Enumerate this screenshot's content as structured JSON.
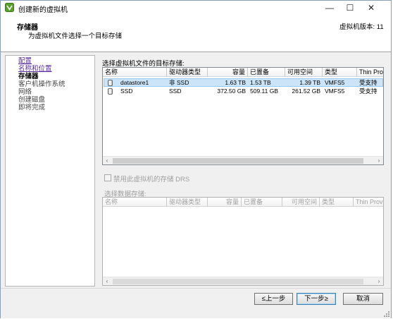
{
  "window": {
    "title": "创建新的虚拟机",
    "header_title": "存储器",
    "header_subtitle": "为虚拟机文件选择一个目标存储",
    "version_label": "虚拟机版本: 11"
  },
  "nav": {
    "items": [
      {
        "label": "配置",
        "state": "link"
      },
      {
        "label": "名称和位置",
        "state": "link"
      },
      {
        "label": "存储器",
        "state": "current"
      },
      {
        "label": "客户机操作系统",
        "state": "future"
      },
      {
        "label": "网络",
        "state": "future"
      },
      {
        "label": "创建磁盘",
        "state": "future"
      },
      {
        "label": "即将完成",
        "state": "future"
      }
    ]
  },
  "storage": {
    "section_label": "选择虚拟机文件的目标存储:",
    "columns": [
      "名称",
      "驱动器类型",
      "容量",
      "已置备",
      "可用空间",
      "类型",
      "Thin Provi"
    ],
    "rows": [
      {
        "name": "datastore1",
        "drive_type": "非 SSD",
        "capacity": "1.63 TB",
        "provisioned": "1.53 TB",
        "free": "1.39 TB",
        "type": "VMFS5",
        "thin": "受支持",
        "selected": true
      },
      {
        "name": "SSD",
        "drive_type": "SSD",
        "capacity": "372.50 GB",
        "provisioned": "509.11 GB",
        "free": "261.52 GB",
        "type": "VMFS5",
        "thin": "受支持",
        "selected": false
      }
    ]
  },
  "drs": {
    "label": "禁用此虚拟机的存储 DRS",
    "checked": false
  },
  "datastore_select": {
    "label": "选择数据存储:",
    "columns": [
      "名称",
      "驱动器类型",
      "容量",
      "已置备",
      "可用空间",
      "类型",
      "Thin Provi"
    ]
  },
  "buttons": {
    "back": "≤上一步",
    "next": "下一步≥",
    "cancel": "取消"
  },
  "scroll": {
    "left_arrow": "‹",
    "right_arrow": "›"
  },
  "colors": {
    "selection": "#cce4f7",
    "link": "#5a2ca0"
  }
}
